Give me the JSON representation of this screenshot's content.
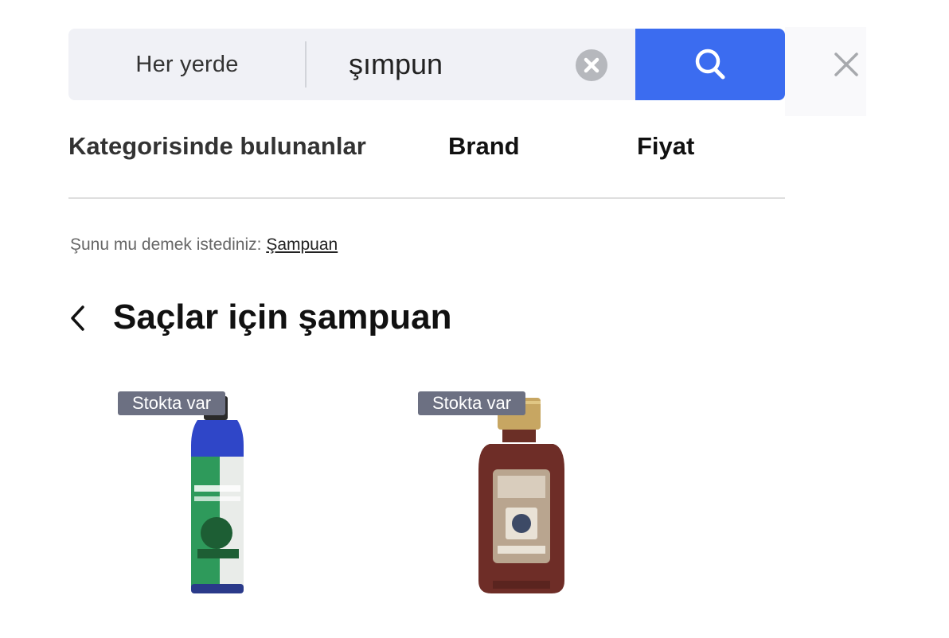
{
  "search": {
    "scope_label": "Her yerde",
    "query": "şımpun",
    "clear_icon": "clear-circle-icon",
    "search_icon": "search-icon",
    "close_icon": "close-icon",
    "accent_color": "#3b6cf0"
  },
  "tabs": [
    {
      "label": "Kategorisinde bulunanlar"
    },
    {
      "label": "Brand"
    },
    {
      "label": "Fiyat"
    }
  ],
  "suggestion": {
    "prefix": "Şunu mu demek istediniz:",
    "link": "Şampuan"
  },
  "section": {
    "back_icon": "chevron-left-icon",
    "title": "Saçlar için şampuan"
  },
  "products": [
    {
      "badge": "Stokta var"
    },
    {
      "badge": "Stokta var"
    }
  ]
}
